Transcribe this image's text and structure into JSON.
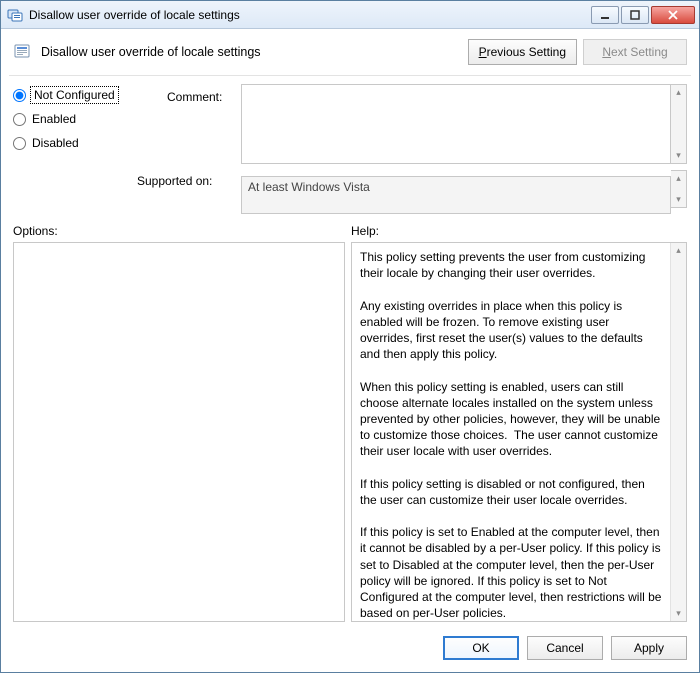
{
  "window": {
    "title": "Disallow user override of locale settings"
  },
  "header": {
    "title": "Disallow user override of locale settings",
    "prev_button_html": "<span class='ul'>P</span>revious Setting",
    "next_button_html": "<span class='ul'>N</span>ext Setting"
  },
  "state": {
    "options": [
      "Not Configured",
      "Enabled",
      "Disabled"
    ],
    "selected": "Not Configured"
  },
  "labels": {
    "comment": "Comment:",
    "supported_on": "Supported on:",
    "options": "Options:",
    "help": "Help:"
  },
  "fields": {
    "comment_value": "",
    "supported_on_value": "At least Windows Vista"
  },
  "help_text": "This policy setting prevents the user from customizing their locale by changing their user overrides.\n\nAny existing overrides in place when this policy is enabled will be frozen. To remove existing user overrides, first reset the user(s) values to the defaults and then apply this policy.\n\nWhen this policy setting is enabled, users can still choose alternate locales installed on the system unless prevented by other policies, however, they will be unable to customize those choices.  The user cannot customize their user locale with user overrides.\n\nIf this policy setting is disabled or not configured, then the user can customize their user locale overrides.\n\nIf this policy is set to Enabled at the computer level, then it cannot be disabled by a per-User policy. If this policy is set to Disabled at the computer level, then the per-User policy will be ignored. If this policy is set to Not Configured at the computer level, then restrictions will be based on per-User policies.\n\nTo set this policy on a per-user basis, make sure that the per-computer policy is set to Not Configured.",
  "footer": {
    "ok": "OK",
    "cancel": "Cancel",
    "apply": "Apply"
  }
}
